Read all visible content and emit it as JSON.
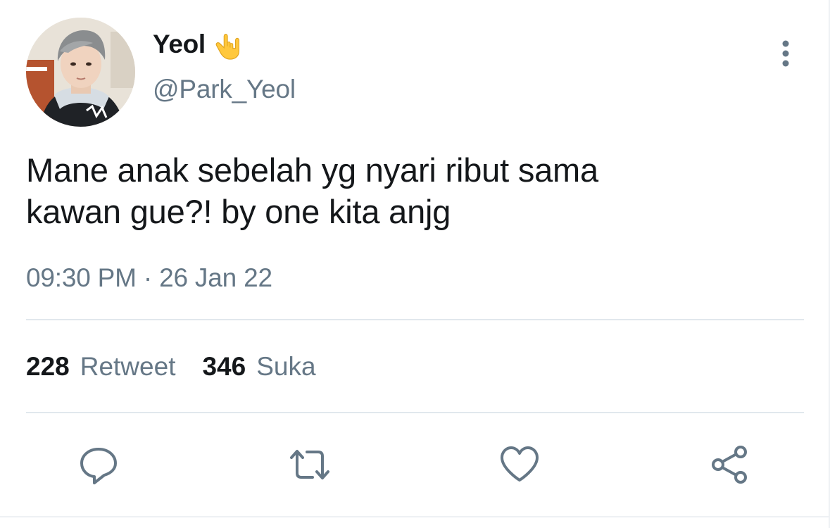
{
  "author": {
    "display_name": "Yeol",
    "name_emoji": "🤟",
    "handle": "@Park_Yeol",
    "avatar_icon": "profile-photo"
  },
  "tweet": {
    "text_line1": "Mane anak sebelah yg nyari ribut sama",
    "text_line2": "kawan gue?! by one kita anjg",
    "time": "09:30 PM",
    "separator": "·",
    "date": "26 Jan 22"
  },
  "stats": {
    "retweet_count": "228",
    "retweet_label": "Retweet",
    "like_count": "346",
    "like_label": "Suka"
  },
  "actions": {
    "reply_icon": "reply-icon",
    "retweet_icon": "retweet-icon",
    "like_icon": "heart-icon",
    "share_icon": "share-icon",
    "more_icon": "more-vertical-icon"
  },
  "colors": {
    "text_primary": "#14171a",
    "text_secondary": "#657786",
    "divider": "#e1e8ed",
    "icon": "#657786"
  }
}
